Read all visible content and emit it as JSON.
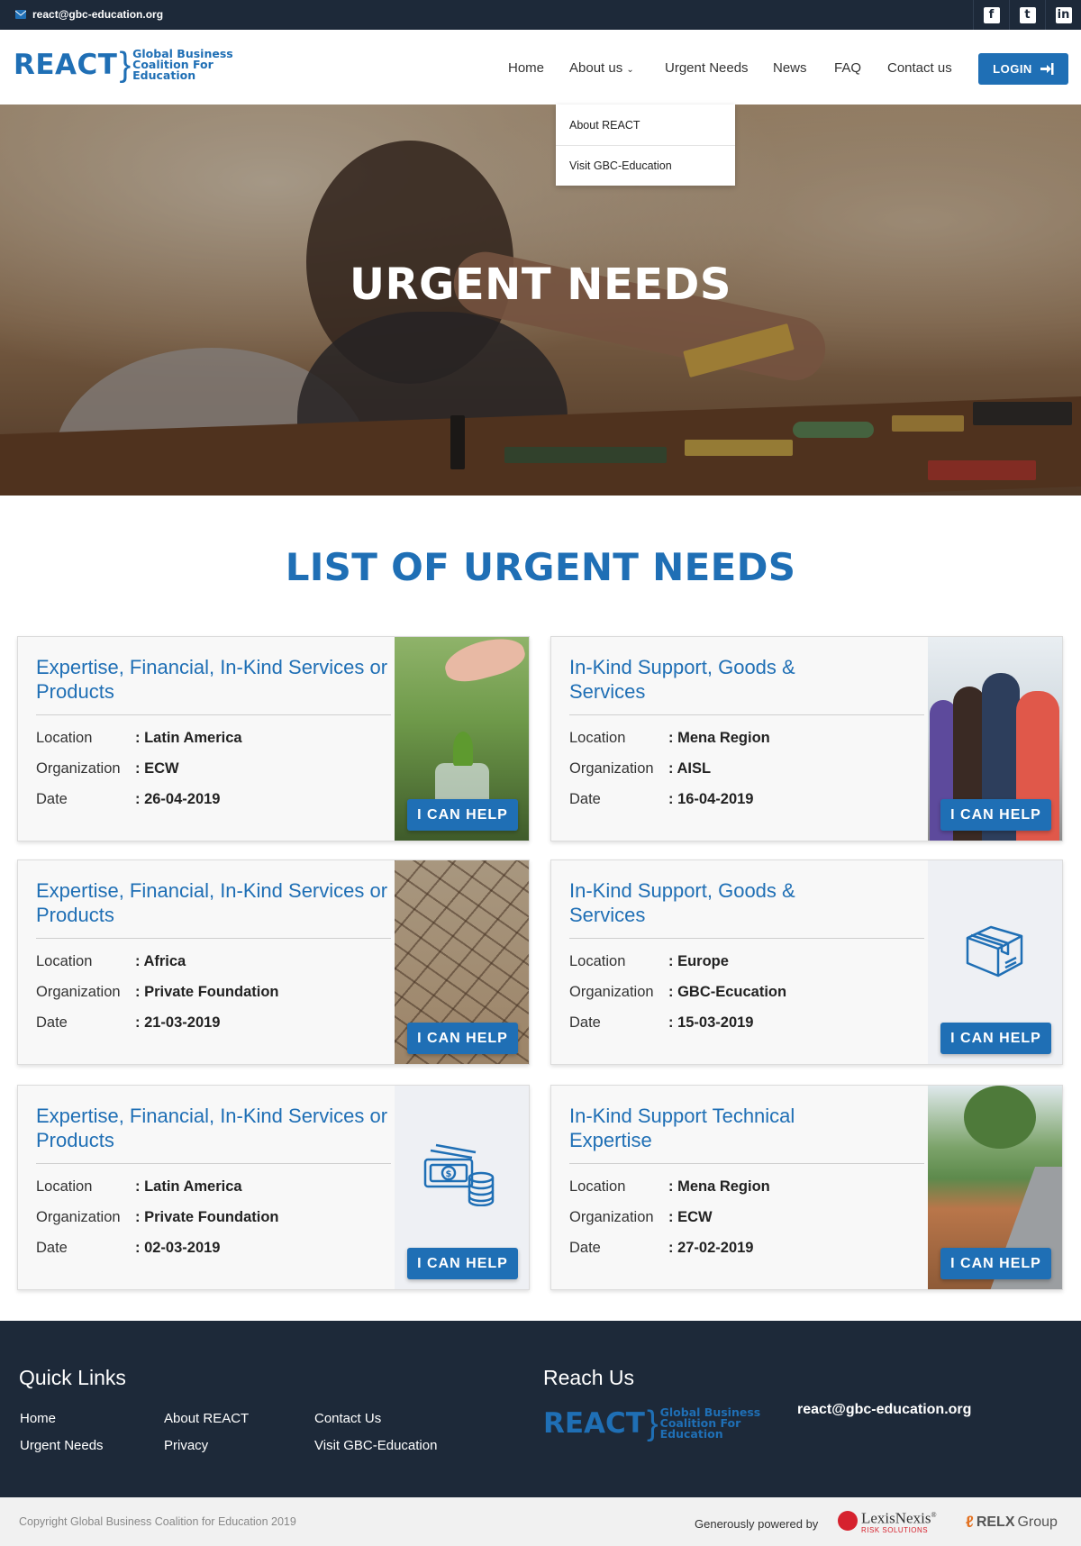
{
  "topbar": {
    "email": "react@gbc-education.org",
    "social": [
      {
        "icon": "facebook-icon",
        "glyph": "f"
      },
      {
        "icon": "twitter-icon",
        "glyph": "t"
      },
      {
        "icon": "linkedin-icon",
        "glyph": "in"
      }
    ]
  },
  "logo": {
    "big": "REACT",
    "line1": "Global Business",
    "line2": "Coalition For",
    "line3": "Education"
  },
  "nav": {
    "home": "Home",
    "about": "About us",
    "urgent": "Urgent Needs",
    "news": "News",
    "faq": "FAQ",
    "contact": "Contact us",
    "login": "LOGIN"
  },
  "dropdown": {
    "items": [
      "About REACT",
      "Visit GBC-Education"
    ]
  },
  "hero": {
    "title": "URGENT NEEDS"
  },
  "section": {
    "title": "LIST OF URGENT NEEDS"
  },
  "labels": {
    "location": "Location",
    "organization": "Organization",
    "date": "Date",
    "help": "I CAN HELP"
  },
  "cards": [
    {
      "title": "Expertise, Financial, In-Kind Services or Products",
      "location": ": Latin America",
      "organization": ": ECW",
      "date": ": 26-04-2019",
      "image": "plant-photo"
    },
    {
      "title": "In-Kind Support, Goods & Services",
      "location": ": Mena Region",
      "organization": ": AISL",
      "date": ": 16-04-2019",
      "image": "people-photo"
    },
    {
      "title": "Expertise, Financial, In-Kind Services or Products",
      "location": ": Africa",
      "organization": ": Private Foundation",
      "date": ": 21-03-2019",
      "image": "dry-earth-photo"
    },
    {
      "title": "In-Kind Support, Goods & Services",
      "location": ": Europe",
      "organization": ": GBC-Ecucation",
      "date": ": 15-03-2019",
      "image": "box-icon"
    },
    {
      "title": "Expertise, Financial, In-Kind Services or Products",
      "location": ": Latin America",
      "organization": ": Private Foundation",
      "date": ": 02-03-2019",
      "image": "money-icon"
    },
    {
      "title": "In-Kind Support Technical Expertise",
      "location": ": Mena Region",
      "organization": ": ECW",
      "date": ": 27-02-2019",
      "image": "landslide-photo"
    }
  ],
  "footer": {
    "quick_links_title": "Quick Links",
    "reach_us_title": "Reach Us",
    "links": [
      "Home",
      "About REACT",
      "Contact Us",
      "Urgent Needs",
      "Privacy",
      "Visit GBC-Education"
    ],
    "email": "react@gbc-education.org",
    "copyright": "Copyright Global Business Coalition for Education 2019",
    "powered": "Generously powered by",
    "lexis_1": "LexisNexis",
    "lexis_reg": "®",
    "lexis_2": "RISK SOLUTIONS",
    "relx": "RELX",
    "relx_group": "Group"
  },
  "colors": {
    "brand_blue": "#1f6fb5",
    "dark_navy": "#1d2939"
  }
}
